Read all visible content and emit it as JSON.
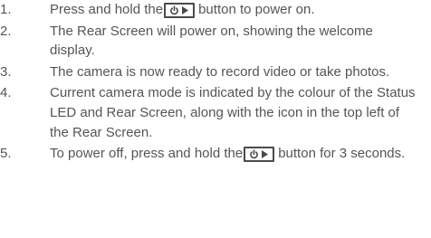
{
  "steps": [
    {
      "number": "1.",
      "before": "Press and hold the",
      "key_icon": "power-play-button-icon",
      "after": "button to power on."
    },
    {
      "number": "2.",
      "text": "The Rear Screen will power on, showing the welcome display."
    },
    {
      "number": "3.",
      "text": "The camera is now ready to record video or take photos."
    },
    {
      "number": "4.",
      "text": "Current camera mode is indicated by the colour of  the Status LED and Rear Screen, along with the icon in the top left of the Rear Screen."
    },
    {
      "number": "5.",
      "before": "To power off, press and hold the",
      "key_icon": "power-play-button-icon",
      "after": "button for 3 seconds."
    }
  ],
  "colors": {
    "text": "#555555",
    "key_border": "#4a4a4a"
  }
}
